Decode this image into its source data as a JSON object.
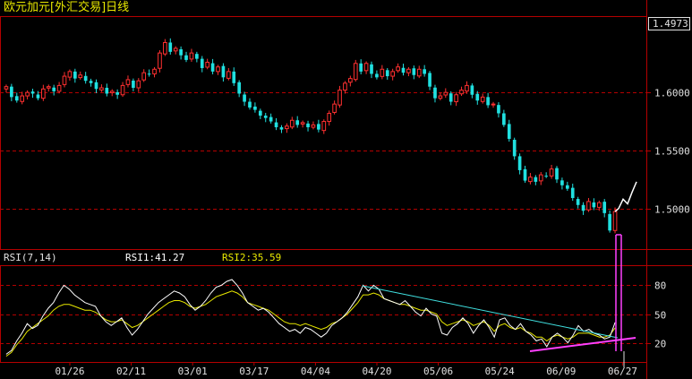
{
  "title": "欧元加元[外汇交易]日线",
  "price_label": "1.4973",
  "rsi_header": {
    "name": "RSI(7,14)",
    "rsi1": "RSI1:41.27",
    "rsi2": "RSI2:35.59"
  },
  "colors": {
    "background": "#000000",
    "frame": "#b40000",
    "grid": "#b40000",
    "axis_text": "#e0e0e0",
    "up_candle": "#ff3030",
    "down_candle": "#20e0e0",
    "rsi1": "#ffffff",
    "rsi2": "#e8e800",
    "trend_cyan": "#40e0e0",
    "trend_magenta": "#ff40ff",
    "extension": "#ffffff"
  },
  "chart_data": [
    {
      "type": "candlestick",
      "title": "欧元加元[外汇交易]日线",
      "y_ticks": [
        1.5,
        1.55,
        1.6
      ],
      "y_tick_labels": [
        "1.5000",
        "1.5500",
        "1.6000"
      ],
      "ylim": [
        1.465,
        1.665
      ],
      "x_tick_labels": [
        "01/26",
        "02/11",
        "03/01",
        "03/17",
        "04/04",
        "04/20",
        "05/06",
        "05/24",
        "06/09",
        "06/27"
      ],
      "closes": [
        1.605,
        1.596,
        1.593,
        1.597,
        1.6,
        1.599,
        1.595,
        1.603,
        1.605,
        1.601,
        1.606,
        1.614,
        1.618,
        1.612,
        1.615,
        1.61,
        1.608,
        1.603,
        1.604,
        1.599,
        1.601,
        1.598,
        1.606,
        1.611,
        1.604,
        1.61,
        1.617,
        1.616,
        1.62,
        1.634,
        1.643,
        1.635,
        1.638,
        1.632,
        1.628,
        1.634,
        1.629,
        1.621,
        1.626,
        1.618,
        1.622,
        1.613,
        1.618,
        1.608,
        1.599,
        1.592,
        1.587,
        1.585,
        1.58,
        1.578,
        1.575,
        1.57,
        1.568,
        1.571,
        1.576,
        1.572,
        1.574,
        1.57,
        1.572,
        1.568,
        1.575,
        1.582,
        1.59,
        1.602,
        1.608,
        1.612,
        1.625,
        1.618,
        1.625,
        1.616,
        1.613,
        1.62,
        1.614,
        1.618,
        1.622,
        1.617,
        1.62,
        1.615,
        1.62,
        1.616,
        1.605,
        1.595,
        1.597,
        1.6,
        1.592,
        1.598,
        1.602,
        1.606,
        1.598,
        1.593,
        1.596,
        1.589,
        1.59,
        1.582,
        1.572,
        1.56,
        1.545,
        1.533,
        1.524,
        1.527,
        1.523,
        1.529,
        1.528,
        1.534,
        1.525,
        1.52,
        1.517,
        1.509,
        1.503,
        1.498,
        1.506,
        1.501,
        1.505,
        1.496,
        1.481,
        1.4973
      ],
      "extension_line": [
        1.5,
        1.508,
        1.504,
        1.514,
        1.523
      ]
    },
    {
      "type": "line",
      "title": "RSI(7,14)",
      "y_ticks": [
        20,
        50,
        80
      ],
      "ylim": [
        0,
        100
      ],
      "series": [
        {
          "name": "RSI1",
          "values": [
            8,
            12,
            22,
            30,
            40,
            35,
            38,
            48,
            56,
            62,
            72,
            80,
            76,
            70,
            66,
            62,
            60,
            58,
            48,
            42,
            38,
            42,
            46,
            36,
            28,
            34,
            42,
            50,
            56,
            62,
            66,
            70,
            74,
            72,
            68,
            60,
            54,
            58,
            64,
            72,
            78,
            80,
            84,
            86,
            80,
            72,
            62,
            58,
            54,
            56,
            52,
            46,
            40,
            36,
            32,
            34,
            30,
            36,
            34,
            30,
            26,
            30,
            38,
            42,
            46,
            52,
            60,
            68,
            80,
            74,
            80,
            76,
            66,
            64,
            62,
            60,
            64,
            58,
            52,
            48,
            56,
            50,
            48,
            30,
            28,
            36,
            40,
            46,
            40,
            30,
            38,
            44,
            36,
            26,
            44,
            46,
            38,
            34,
            40,
            32,
            28,
            22,
            24,
            16,
            26,
            30,
            26,
            20,
            28,
            38,
            32,
            34,
            30,
            28,
            24,
            26,
            41.27
          ]
        },
        {
          "name": "RSI2",
          "values": [
            6,
            10,
            18,
            24,
            32,
            36,
            40,
            44,
            48,
            54,
            58,
            60,
            60,
            58,
            56,
            54,
            54,
            52,
            48,
            44,
            42,
            42,
            44,
            40,
            36,
            38,
            42,
            46,
            50,
            54,
            58,
            62,
            64,
            64,
            62,
            58,
            56,
            58,
            60,
            64,
            68,
            70,
            72,
            74,
            72,
            68,
            62,
            60,
            58,
            56,
            54,
            50,
            46,
            42,
            40,
            40,
            38,
            40,
            38,
            36,
            34,
            36,
            40,
            42,
            46,
            50,
            56,
            62,
            70,
            70,
            72,
            70,
            66,
            64,
            62,
            60,
            60,
            58,
            56,
            54,
            54,
            52,
            50,
            42,
            38,
            40,
            42,
            44,
            42,
            38,
            40,
            42,
            38,
            32,
            38,
            40,
            36,
            34,
            36,
            32,
            30,
            26,
            26,
            22,
            26,
            28,
            26,
            24,
            26,
            30,
            30,
            30,
            28,
            26,
            26,
            28,
            35.59
          ]
        }
      ],
      "annotations": [
        "cyan descending trendline over RSI peaks",
        "magenta rising trendline under RSI lows"
      ]
    }
  ]
}
